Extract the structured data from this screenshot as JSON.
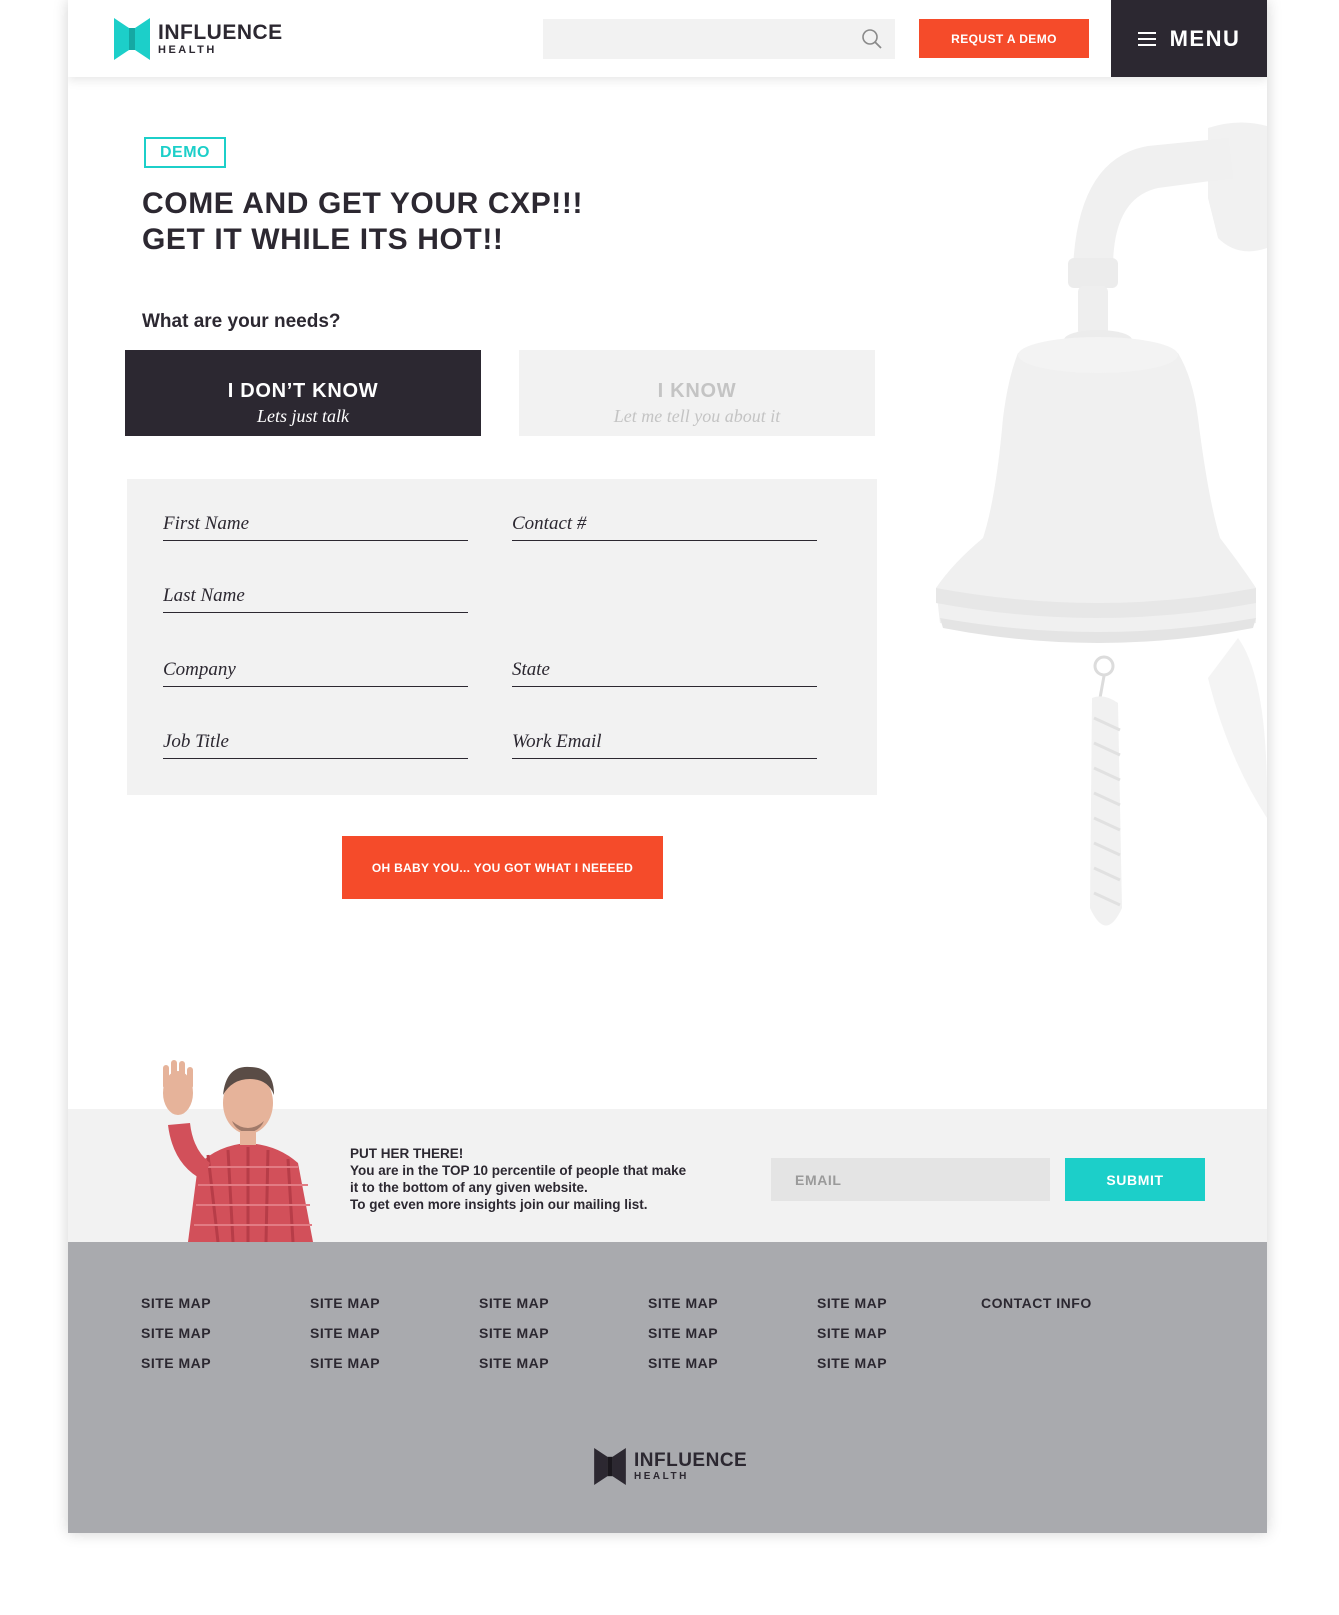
{
  "header": {
    "logo": {
      "name": "INFLUENCE",
      "sub": "HEALTH"
    },
    "search": {
      "placeholder": "",
      "icon": "search-icon"
    },
    "demo_button": "REQUST A DEMO",
    "menu": {
      "label": "MENU",
      "icon": "hamburger-icon"
    }
  },
  "hero": {
    "tag": "DEMO",
    "headline_line1": "COME AND GET YOUR CXP!!!",
    "headline_line2": "GET IT WHILE ITS HOT!!",
    "needs_label": "What are your needs?",
    "choices": [
      {
        "title": "I DON’T KNOW",
        "subtitle": "Lets just talk",
        "selected": true
      },
      {
        "title": "I KNOW",
        "subtitle": "Let me tell you about it",
        "selected": false
      }
    ]
  },
  "form": {
    "fields": {
      "first_name": "First Name",
      "contact": "Contact #",
      "last_name": "Last Name",
      "company": "Company",
      "state": "State",
      "job_title": "Job Title",
      "work_email": "Work Email"
    },
    "submit": "OH BABY YOU... YOU GOT WHAT I NEEEED"
  },
  "newsletter": {
    "line1": "PUT HER THERE!",
    "line2": "You are in the TOP 10 percentile of people that make",
    "line3": "it to the bottom of any given website.",
    "line4": "To get even more insights join our mailing list.",
    "email_placeholder": "EMAIL",
    "submit": "SUBMIT"
  },
  "footer": {
    "columns": [
      [
        "SITE MAP",
        "SITE MAP",
        "SITE MAP"
      ],
      [
        "SITE MAP",
        "SITE MAP",
        "SITE MAP"
      ],
      [
        "SITE MAP",
        "SITE MAP",
        "SITE MAP"
      ],
      [
        "SITE MAP",
        "SITE MAP",
        "SITE MAP"
      ],
      [
        "SITE MAP",
        "SITE MAP",
        "SITE MAP"
      ]
    ],
    "contact": "CONTACT INFO",
    "logo": {
      "name": "INFLUENCE",
      "sub": "HEALTH"
    }
  },
  "colors": {
    "accent_orange": "#f54b2a",
    "accent_teal": "#1ccfc9",
    "dark": "#2c2831",
    "panel": "#f2f2f2",
    "footer": "#a9aaae"
  }
}
